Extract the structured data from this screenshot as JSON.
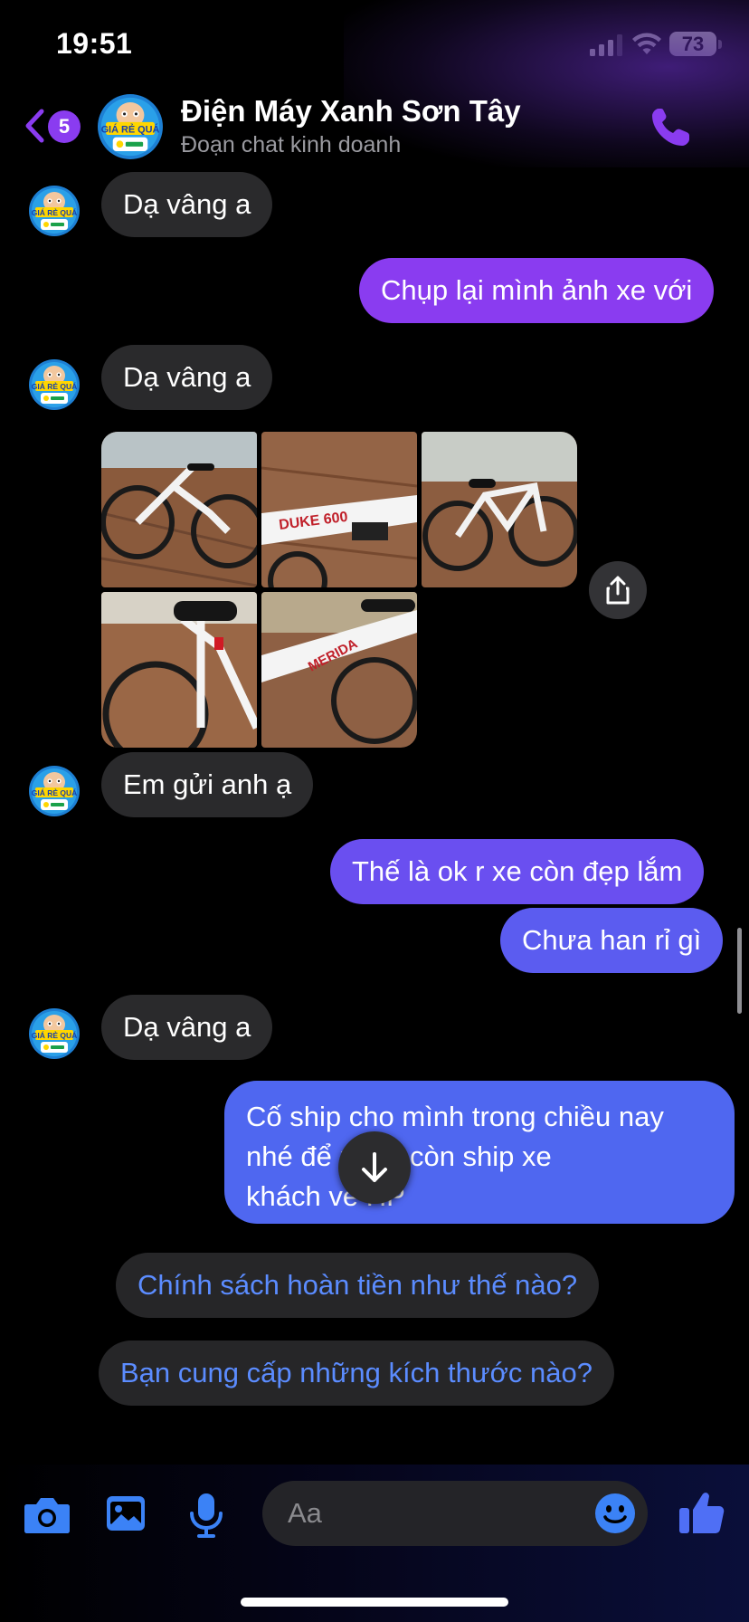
{
  "status_bar": {
    "time": "19:51",
    "battery": "73"
  },
  "header": {
    "back_count": "5",
    "title": "Điện Máy Xanh Sơn Tây",
    "subtitle": "Đoạn chat kinh doanh"
  },
  "messages": [
    {
      "from": "them",
      "text": "Dạ vâng a"
    },
    {
      "from": "me",
      "text": "Chụp lại mình ảnh xe với"
    },
    {
      "from": "them",
      "text": "Dạ vâng a"
    },
    {
      "from": "them",
      "type": "photos",
      "count": 5
    },
    {
      "from": "them",
      "text": "Em gửi anh ạ"
    },
    {
      "from": "me",
      "text": "Thế là ok r xe còn đẹp lắm"
    },
    {
      "from": "me",
      "text": "Chưa han rỉ gì"
    },
    {
      "from": "them",
      "text": "Dạ vâng a"
    },
    {
      "from": "me",
      "lines": [
        "Cố ship cho mình trong chiều nay",
        "nhé để    mình còn ship xe",
        "khách về HP"
      ]
    }
  ],
  "suggestions": [
    "Chính sách hoàn tiền như thế nào?",
    "Bạn cung cấp những kích thước nào?"
  ],
  "composer": {
    "placeholder": "Aa"
  },
  "colors": {
    "accent": "#8a3cf0",
    "outgoing_start": "#8a3cf0",
    "outgoing_end": "#4f67f0",
    "incoming": "#2a2a2c",
    "suggestion_text": "#5b8cff"
  },
  "icons": {
    "back": "chevron-left-icon",
    "call": "phone-icon",
    "share": "share-icon",
    "scroll_down": "arrow-down-icon",
    "camera": "camera-icon",
    "gallery": "image-icon",
    "mic": "microphone-icon",
    "emoji": "smiley-icon",
    "like": "thumbs-up-icon"
  }
}
